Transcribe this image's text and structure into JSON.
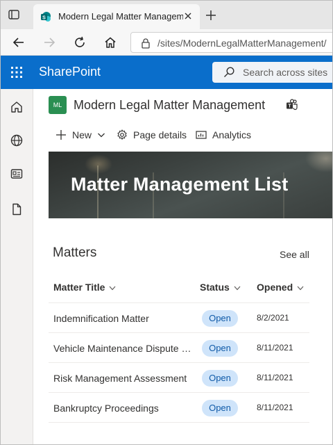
{
  "browser": {
    "tab_title": "Modern Legal Matter Management",
    "url": "/sites/ModernLegalMatterManagement/"
  },
  "suite": {
    "app_name": "SharePoint",
    "search_placeholder": "Search across sites"
  },
  "site": {
    "logo_initials": "ML",
    "title": "Modern Legal Matter Management"
  },
  "command_bar": {
    "new_label": "New",
    "page_details_label": "Page details",
    "analytics_label": "Analytics"
  },
  "banner": {
    "title": "Matter Management List"
  },
  "matters": {
    "title": "Matters",
    "see_all": "See all",
    "columns": [
      "Matter Title",
      "Status",
      "Opened"
    ],
    "rows": [
      {
        "title": "Indemnification Matter",
        "status": "Open",
        "opened": "8/2/2021"
      },
      {
        "title": "Vehicle Maintenance Dispute Resolution",
        "status": "Open",
        "opened": "8/11/2021"
      },
      {
        "title": "Risk Management Assessment",
        "status": "Open",
        "opened": "8/11/2021"
      },
      {
        "title": "Bankruptcy Proceedings",
        "status": "Open",
        "opened": "8/11/2021"
      }
    ]
  },
  "colors": {
    "suite_bar": "#0a6ecb",
    "site_logo": "#2a8f52",
    "status_badge_bg": "#cfe4fa",
    "status_badge_text": "#0f5aa8"
  },
  "icons": {
    "tab_strip": [
      "window-icon",
      "sharepoint-favicon-icon",
      "close-icon",
      "plus-icon"
    ],
    "navigation": [
      "back-arrow-icon",
      "forward-arrow-icon",
      "refresh-icon",
      "home-icon",
      "lock-icon"
    ],
    "left_rail": [
      "home-icon",
      "globe-icon",
      "news-icon",
      "document-icon"
    ],
    "header": [
      "teams-icon"
    ],
    "commands": [
      "plus-icon",
      "chevron-down-icon",
      "gear-icon",
      "analytics-icon"
    ]
  }
}
